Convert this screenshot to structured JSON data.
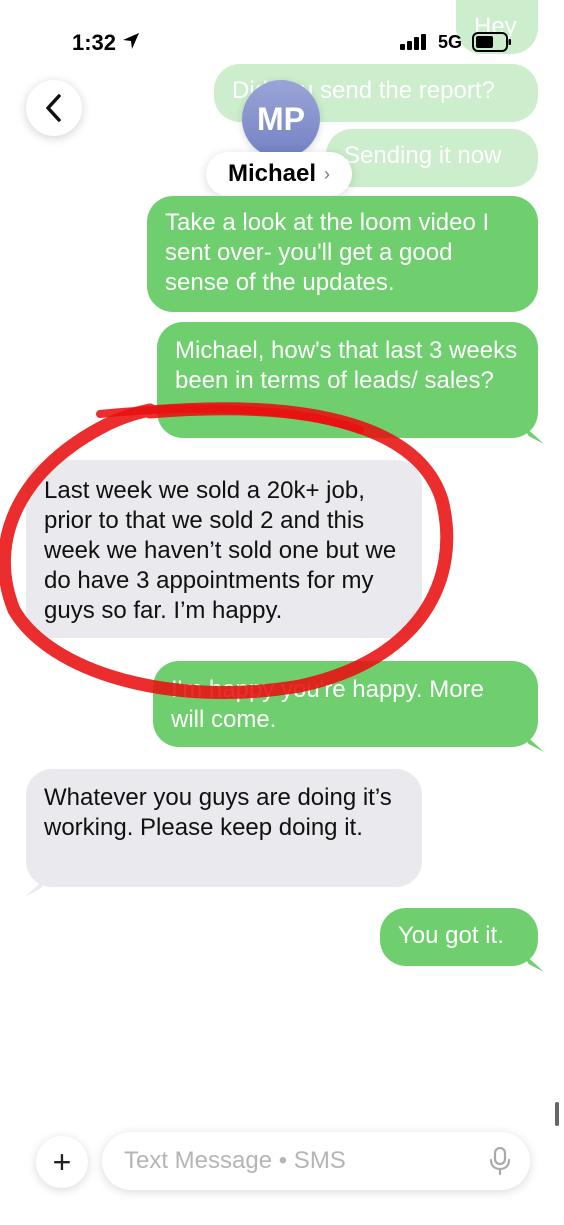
{
  "status_bar": {
    "time": "1:32",
    "network": "5G"
  },
  "header": {
    "avatar_initials": "MP",
    "contact_name": "Michael"
  },
  "messages": [
    {
      "text": "Hey"
    },
    {
      "text": "Did you send the report?"
    },
    {
      "text": "Sending it now"
    },
    {
      "text": "Take a look at the loom video I sent over- you'll get a good sense of the updates."
    },
    {
      "text": "Michael, how's that last 3 weeks been in terms of leads/ sales?"
    },
    {
      "text": "Last week we sold a 20k+ job, prior to that we sold 2 and this week we haven’t sold one but we do have 3 appointments for my guys so far. I’m happy."
    },
    {
      "text": "I'm happy you're happy. More will come."
    },
    {
      "text": "Whatever you guys are doing it’s working. Please keep doing it."
    },
    {
      "text": "You got it."
    }
  ],
  "composer": {
    "placeholder": "Text Message • SMS"
  },
  "colors": {
    "sent": "#6fcf6f",
    "received": "#e9e9ee",
    "annotation": "#e81010"
  }
}
